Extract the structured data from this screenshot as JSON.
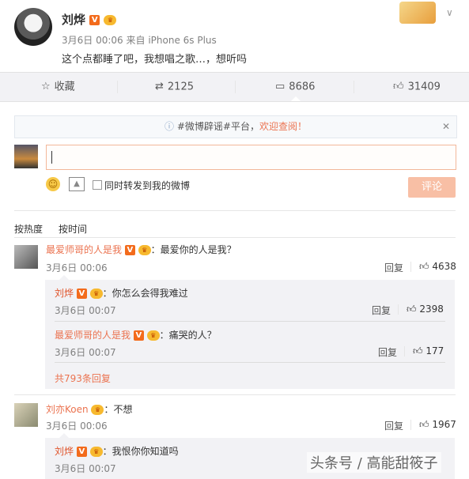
{
  "post": {
    "author": "刘烨",
    "time": "3月6日 00:06",
    "source_prefix": "来自",
    "source": "iPhone 6s Plus",
    "text": "这个点都睡了吧，我想唱之歌…，想听吗"
  },
  "actions": {
    "favorite": "收藏",
    "repost": "2125",
    "comment": "8686",
    "like": "31409"
  },
  "notice": {
    "tag": "#微博辟谣#平台，",
    "link": "欢迎查阅！"
  },
  "composer": {
    "checkbox_label": "同时转发到我的微博",
    "submit_label": "评论"
  },
  "sort": {
    "hot": "按热度",
    "time": "按时间"
  },
  "comments": [
    {
      "user": "最爱师哥的人是我",
      "text": "：最爱你的人是我？",
      "time": "3月6日 00:06",
      "reply_label": "回复",
      "likes": "4638",
      "replies": [
        {
          "user": "刘烨",
          "text": "：你怎么会得我难过",
          "time": "3月6日 00:07",
          "reply_label": "回复",
          "likes": "2398"
        },
        {
          "user": "最爱师哥的人是我",
          "text": "：痛哭的人？",
          "time": "3月6日 00:07",
          "reply_label": "回复",
          "likes": "177"
        }
      ],
      "more": "共793条回复"
    },
    {
      "user": "刘亦Koen",
      "text": "：不想",
      "time": "3月6日 00:06",
      "reply_label": "回复",
      "likes": "1967",
      "replies": [
        {
          "user": "刘烨",
          "text": "：我恨你你知道吗",
          "time": "3月6日 00:07"
        }
      ]
    }
  ],
  "watermark": "头条号 / 高能甜筱子"
}
